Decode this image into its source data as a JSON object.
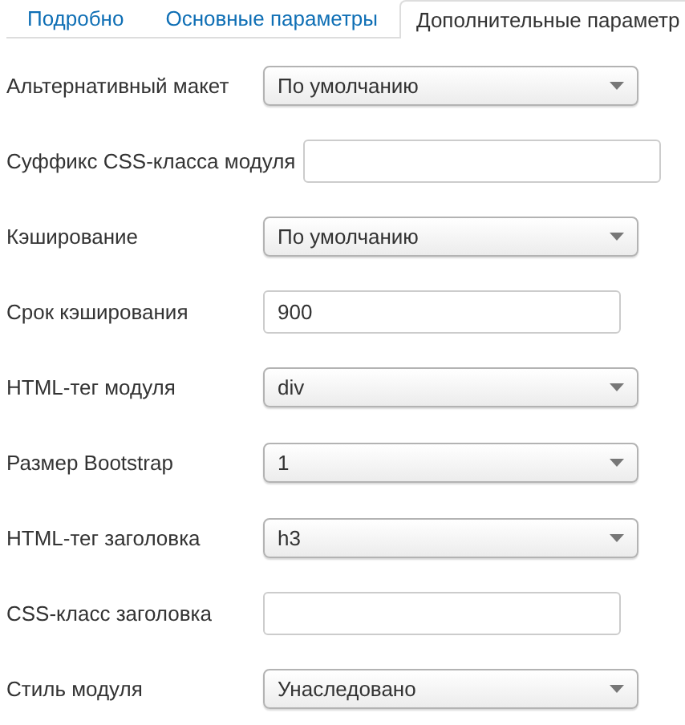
{
  "tabs": [
    {
      "label": "Подробно",
      "selected": false
    },
    {
      "label": "Основные параметры",
      "selected": false
    },
    {
      "label": "Дополнительные параметр",
      "selected": true
    }
  ],
  "fields": [
    {
      "label": "Альтернативный макет",
      "kind": "select",
      "value": "По умолчанию"
    },
    {
      "label": "Суффикс CSS-класса модуля",
      "kind": "text"
    },
    {
      "label": "Кэширование",
      "kind": "select",
      "value": "По умолчанию"
    },
    {
      "label": "Срок кэширования",
      "kind": "text",
      "value": "900"
    },
    {
      "label": "HTML-тег модуля",
      "kind": "select",
      "value": "div"
    },
    {
      "label": "Размер Bootstrap",
      "kind": "select",
      "value": "1"
    },
    {
      "label": "HTML-тег заголовка",
      "kind": "select",
      "value": "h3"
    },
    {
      "label": "CSS-класс заголовка",
      "kind": "text"
    },
    {
      "label": "Стиль модуля",
      "kind": "select",
      "value": "Унаследовано"
    }
  ]
}
